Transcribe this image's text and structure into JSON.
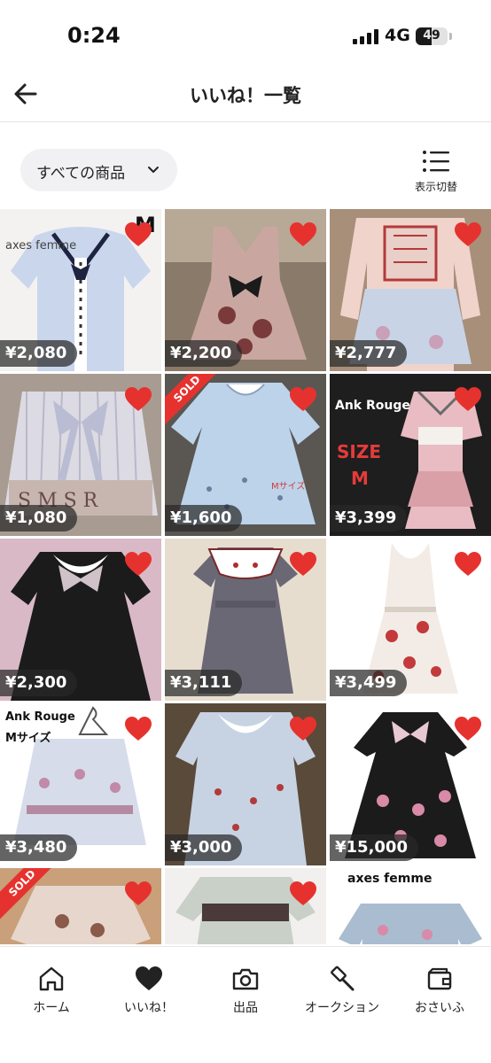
{
  "status_bar": {
    "time": "0:24",
    "network": "4G",
    "battery": "49"
  },
  "header": {
    "title": "いいね！一覧",
    "back_icon": "arrow-left-icon"
  },
  "filter": {
    "label": "すべての商品",
    "chevron_icon": "chevron-down-icon",
    "view_toggle_label": "表示切替",
    "view_toggle_icon": "list-view-icon"
  },
  "colors": {
    "heart": "#e6322e",
    "sold_ribbon": "#e6322e",
    "price_badge": "#3a3a3a",
    "chip_bg": "#f1f1f3"
  },
  "items": [
    {
      "price": "¥2,080",
      "liked": true,
      "sold": false,
      "overlay": "axes femme",
      "overlay2": "M"
    },
    {
      "price": "¥2,200",
      "liked": true,
      "sold": false
    },
    {
      "price": "¥2,777",
      "liked": true,
      "sold": false
    },
    {
      "price": "¥1,080",
      "liked": true,
      "sold": false
    },
    {
      "price": "¥1,600",
      "liked": true,
      "sold": true,
      "sold_label": "SOLD",
      "overlay": "Mサイズ"
    },
    {
      "price": "¥3,399",
      "liked": true,
      "sold": false,
      "overlay": "Ank Rouge",
      "overlay2": "SIZE",
      "overlay3": "M"
    },
    {
      "price": "¥2,300",
      "liked": true,
      "sold": false
    },
    {
      "price": "¥3,111",
      "liked": true,
      "sold": false
    },
    {
      "price": "¥3,499",
      "liked": true,
      "sold": false
    },
    {
      "price": "¥3,480",
      "liked": true,
      "sold": false,
      "overlay": "Ank Rouge",
      "overlay2": "Mサイズ"
    },
    {
      "price": "¥3,000",
      "liked": true,
      "sold": false
    },
    {
      "price": "¥15,000",
      "liked": true,
      "sold": false
    },
    {
      "liked": true,
      "sold": true,
      "sold_label": "SOLD"
    },
    {
      "liked": true,
      "sold": false
    },
    {
      "liked": false,
      "sold": false,
      "overlay": "axes femme"
    }
  ],
  "bottom_nav": [
    {
      "label": "ホーム",
      "icon": "home-icon"
    },
    {
      "label": "いいね！",
      "icon": "heart-icon"
    },
    {
      "label": "出品",
      "icon": "camera-icon"
    },
    {
      "label": "オークション",
      "icon": "gavel-icon"
    },
    {
      "label": "おさいふ",
      "icon": "wallet-icon"
    }
  ]
}
